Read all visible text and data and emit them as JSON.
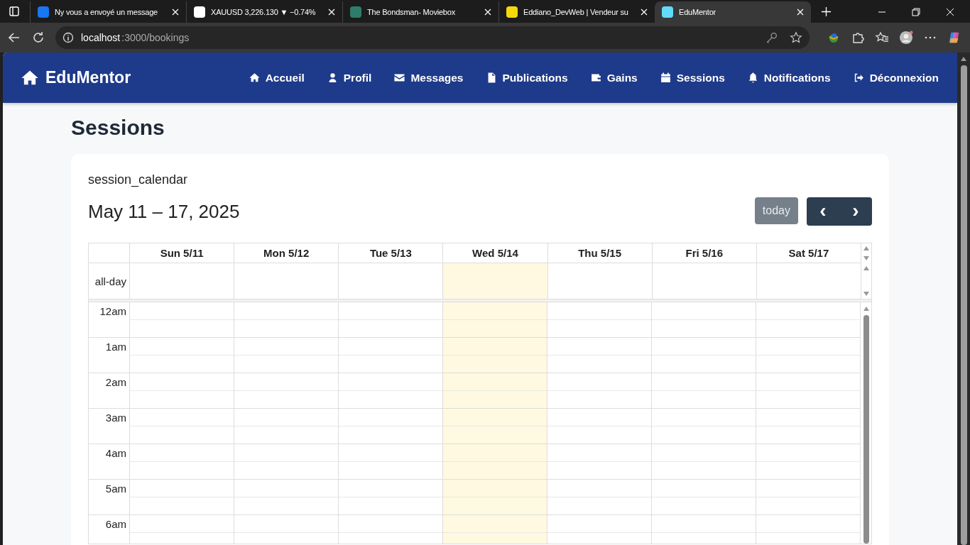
{
  "browser": {
    "tabs": [
      {
        "title": "Ny vous a envoyé un message",
        "selected": false
      },
      {
        "title": "XAUUSD 3,226.130 ▼ −0.74%",
        "selected": false
      },
      {
        "title": "The Bondsman- Moviebox",
        "selected": false
      },
      {
        "title": "Eddiano_DevWeb | Vendeur su",
        "selected": false
      },
      {
        "title": "EduMentor",
        "selected": true
      }
    ],
    "address": {
      "host": "localhost",
      "path": ":3000/bookings"
    }
  },
  "navbar": {
    "brand": "EduMentor",
    "items": [
      "Accueil",
      "Profil",
      "Messages",
      "Publications",
      "Gains",
      "Sessions",
      "Notifications",
      "Déconnexion"
    ]
  },
  "page_title": "Sessions",
  "calendar": {
    "title": "session_calendar",
    "range": "May 11 – 17, 2025",
    "today_button": {
      "label": "today",
      "disabled": true
    },
    "prev_symbol": "‹",
    "next_symbol": "›",
    "days": [
      {
        "label": "Sun 5/11",
        "today": false
      },
      {
        "label": "Mon 5/12",
        "today": false
      },
      {
        "label": "Tue 5/13",
        "today": false
      },
      {
        "label": "Wed 5/14",
        "today": true
      },
      {
        "label": "Thu 5/15",
        "today": false
      },
      {
        "label": "Fri 5/16",
        "today": false
      },
      {
        "label": "Sat 5/17",
        "today": false
      }
    ],
    "all_day_label": "all-day",
    "hours": [
      "12am",
      "1am",
      "2am",
      "3am",
      "4am",
      "5am",
      "6am"
    ]
  }
}
